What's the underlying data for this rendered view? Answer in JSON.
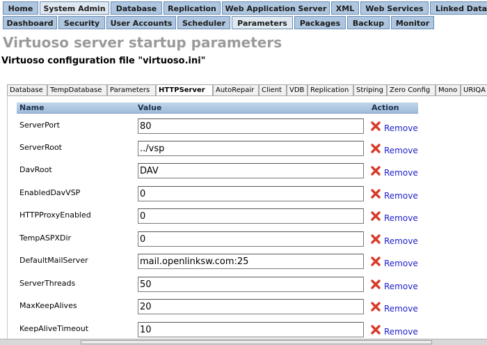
{
  "nav_primary": [
    {
      "label": "Home",
      "active": false
    },
    {
      "label": "System Admin",
      "active": true
    },
    {
      "label": "Database",
      "active": false
    },
    {
      "label": "Replication",
      "active": false
    },
    {
      "label": "Web Application Server",
      "active": false
    },
    {
      "label": "XML",
      "active": false
    },
    {
      "label": "Web Services",
      "active": false
    },
    {
      "label": "Linked Data",
      "active": false
    }
  ],
  "nav_secondary": [
    {
      "label": "Dashboard",
      "active": false
    },
    {
      "label": "Security",
      "active": false
    },
    {
      "label": "User Accounts",
      "active": false
    },
    {
      "label": "Scheduler",
      "active": false
    },
    {
      "label": "Parameters",
      "active": true
    },
    {
      "label": "Packages",
      "active": false
    },
    {
      "label": "Backup",
      "active": false
    },
    {
      "label": "Monitor",
      "active": false
    }
  ],
  "page_title": "Virtuoso server startup parameters",
  "config_title": "Virtuoso configuration file \"virtuoso.ini\"",
  "section_tabs": [
    {
      "label": "Database",
      "active": false
    },
    {
      "label": "TempDatabase",
      "active": false
    },
    {
      "label": "Parameters",
      "active": false
    },
    {
      "label": "HTTPServer",
      "active": true
    },
    {
      "label": "AutoRepair",
      "active": false
    },
    {
      "label": "Client",
      "active": false
    },
    {
      "label": "VDB",
      "active": false
    },
    {
      "label": "Replication",
      "active": false
    },
    {
      "label": "Striping",
      "active": false
    },
    {
      "label": "Zero Config",
      "active": false
    },
    {
      "label": "Mono",
      "active": false
    },
    {
      "label": "URIQA",
      "active": false
    }
  ],
  "table": {
    "headers": {
      "name": "Name",
      "value": "Value",
      "action": "Action"
    },
    "remove_label": "Remove",
    "rows": [
      {
        "name": "ServerPort",
        "value": "80"
      },
      {
        "name": "ServerRoot",
        "value": "../vsp"
      },
      {
        "name": "DavRoot",
        "value": "DAV"
      },
      {
        "name": "EnabledDavVSP",
        "value": "0"
      },
      {
        "name": "HTTPProxyEnabled",
        "value": "0"
      },
      {
        "name": "TempASPXDir",
        "value": "0"
      },
      {
        "name": "DefaultMailServer",
        "value": "mail.openlinksw.com:25"
      },
      {
        "name": "ServerThreads",
        "value": "50"
      },
      {
        "name": "MaxKeepAlives",
        "value": "20"
      },
      {
        "name": "KeepAliveTimeout",
        "value": "10"
      }
    ]
  },
  "colors": {
    "nav_tab": "#aec6df",
    "nav_tab_active": "#dfe8f1",
    "title_gray": "#9a9a9a",
    "remove_link": "#1d1dc9",
    "remove_icon": "#d83a2a"
  },
  "icons": {
    "remove": "red-x-icon"
  }
}
